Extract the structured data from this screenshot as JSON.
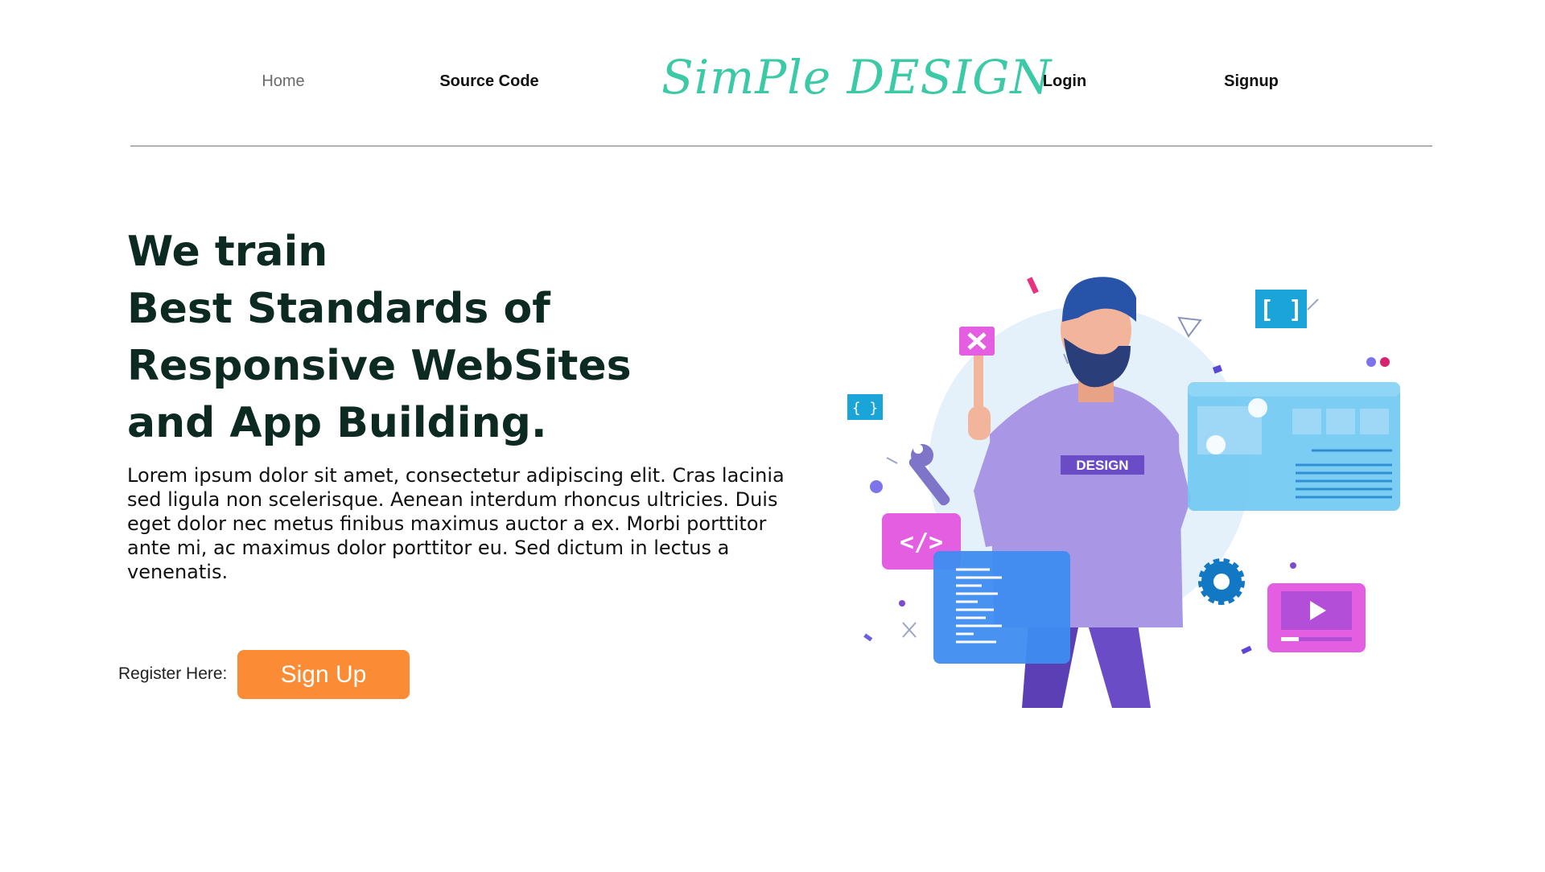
{
  "nav": {
    "home": "Home",
    "source_code": "Source Code",
    "logo": "SimPle DESIGN",
    "login": "Login",
    "signup": "Signup"
  },
  "hero": {
    "title_lines": [
      "We train",
      "Best Standards of",
      "Responsive WebSites",
      "and App Building."
    ],
    "description": "Lorem ipsum dolor sit amet, consectetur adipiscing elit. Cras lacinia sed ligula non scelerisque. Aenean interdum rhoncus ultricies. Duis eget dolor nec metus finibus maximus auctor a ex. Morbi porttitor ante mi, ac maximus dolor porttitor eu. Sed dictum in lectus a venenatis.",
    "register_label": "Register Here:",
    "signup_button": "Sign Up"
  },
  "illustration": {
    "shirt_text": "DESIGN",
    "bracket_icon_small": "{ }",
    "bracket_icon_large": "[ ]",
    "code_icon": "</>"
  },
  "colors": {
    "logo": "#3cc9a6",
    "heading": "#0d2a22",
    "button": "#fb8c35",
    "divider": "#777777"
  }
}
